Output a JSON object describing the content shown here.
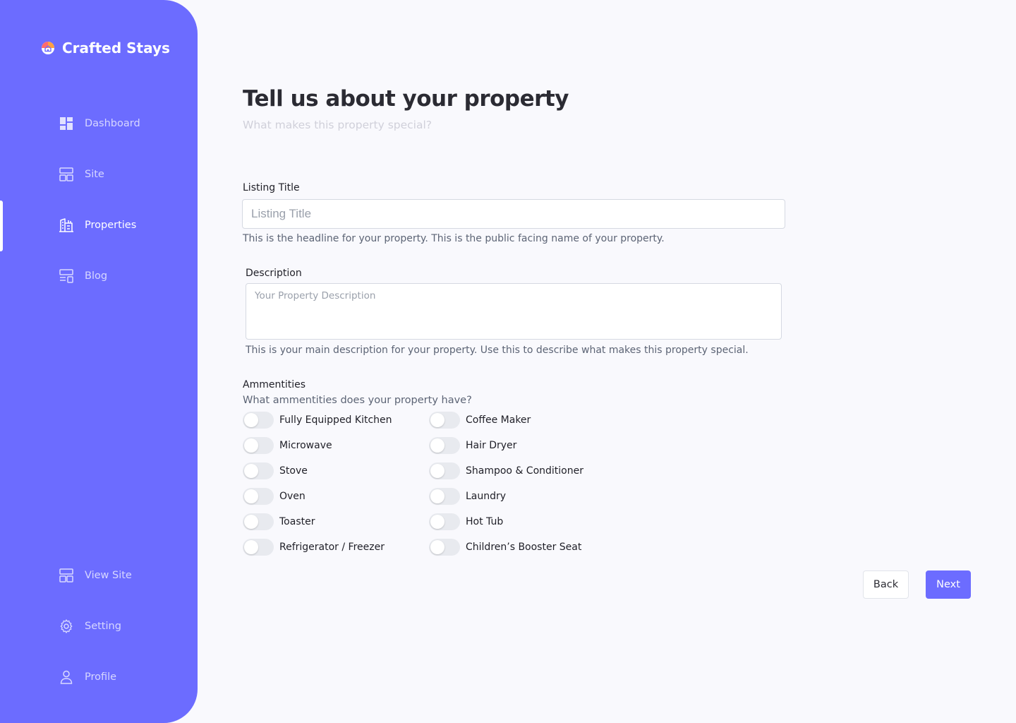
{
  "app": {
    "name": "Crafted Stays"
  },
  "colors": {
    "accent": "#6c6cff",
    "sidebar_text": "#ffffff"
  },
  "nav": {
    "primary": [
      {
        "label": "Dashboard",
        "icon": "dashboard-icon"
      },
      {
        "label": "Site",
        "icon": "site-icon"
      },
      {
        "label": "Properties",
        "icon": "building-icon",
        "active": true
      },
      {
        "label": "Blog",
        "icon": "blog-icon"
      }
    ],
    "secondary": [
      {
        "label": "View Site",
        "icon": "view-site-icon"
      },
      {
        "label": "Setting",
        "icon": "gear-icon"
      },
      {
        "label": "Profile",
        "icon": "user-icon"
      }
    ]
  },
  "page": {
    "title": "Tell us about your property",
    "subtitle": "What makes this property special?"
  },
  "form": {
    "listing_title": {
      "label": "Listing Title",
      "placeholder": "Listing Title",
      "value": "",
      "help": "This is the headline for your property. This is the public facing name of your property."
    },
    "description": {
      "label": "Description",
      "placeholder": "Your Property Description",
      "value": "",
      "help": "This is your main description for your property. Use this to describe what makes this property special."
    },
    "amenities": {
      "label": "Ammentities",
      "question": "What ammentities does your property have?",
      "left": [
        {
          "label": "Fully Equipped Kitchen",
          "checked": false
        },
        {
          "label": "Microwave",
          "checked": false
        },
        {
          "label": "Stove",
          "checked": false
        },
        {
          "label": "Oven",
          "checked": false
        },
        {
          "label": "Toaster",
          "checked": false
        },
        {
          "label": "Refrigerator / Freezer",
          "checked": false
        }
      ],
      "right": [
        {
          "label": "Coffee Maker",
          "checked": false
        },
        {
          "label": "Hair Dryer",
          "checked": false
        },
        {
          "label": "Shampoo & Conditioner",
          "checked": false
        },
        {
          "label": "Laundry",
          "checked": false
        },
        {
          "label": "Hot Tub",
          "checked": false
        },
        {
          "label": "Children’s Booster Seat",
          "checked": false
        }
      ]
    }
  },
  "actions": {
    "back": "Back",
    "next": "Next"
  }
}
